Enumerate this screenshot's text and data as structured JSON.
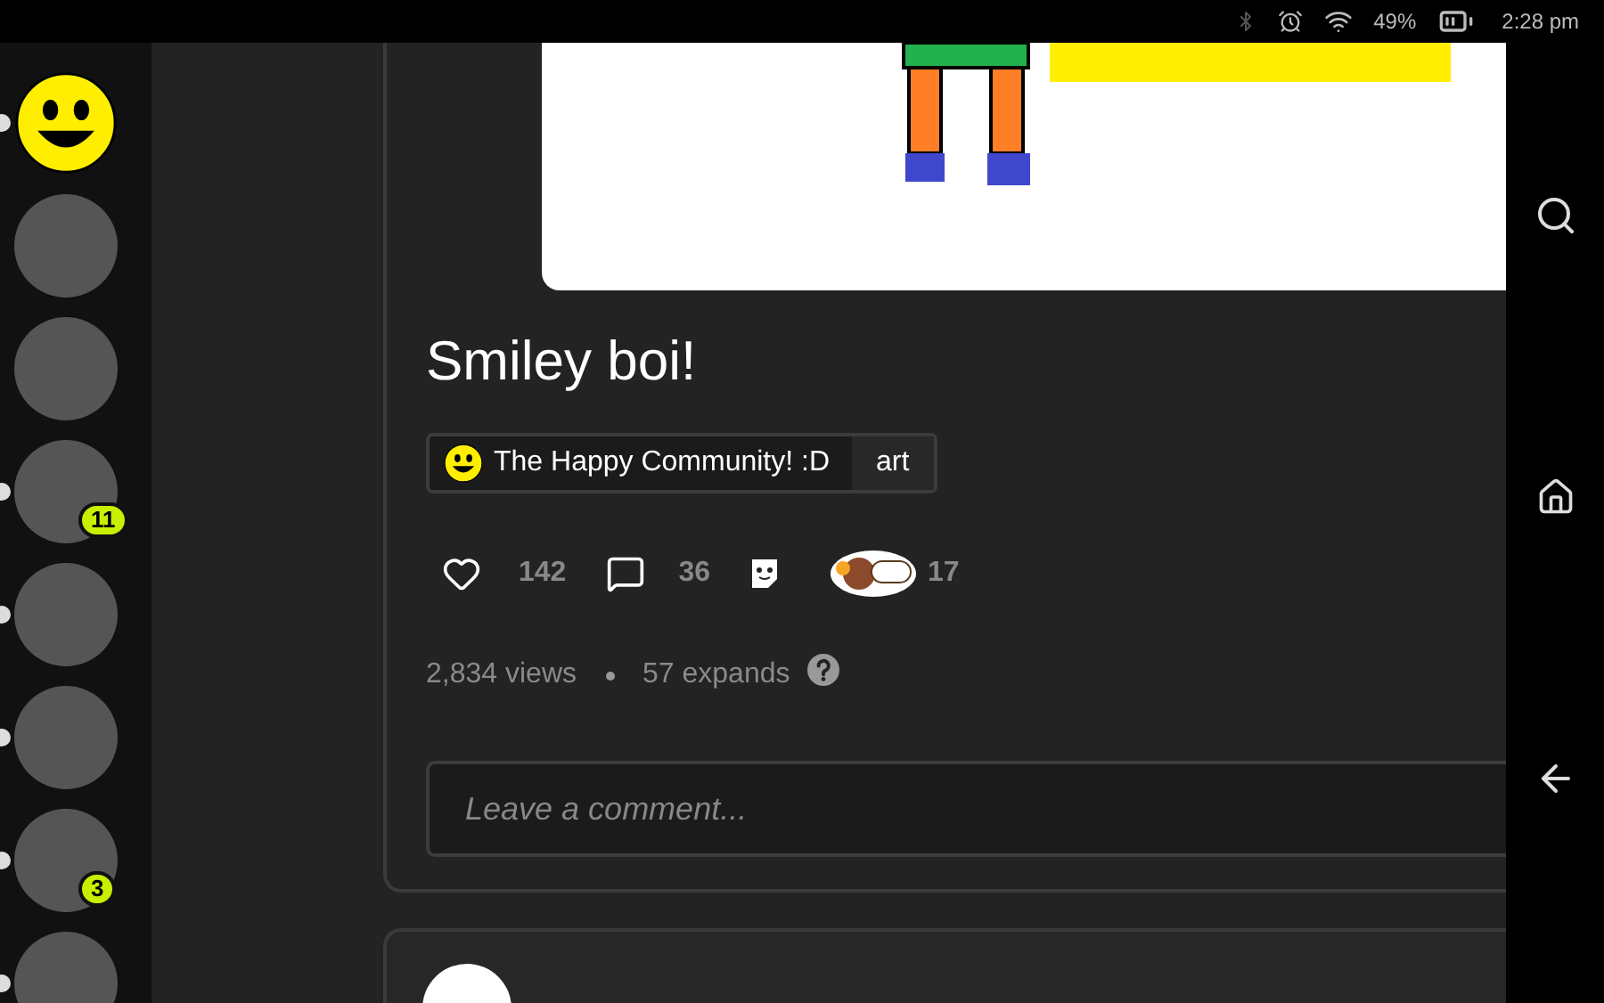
{
  "status_bar": {
    "battery": "49%",
    "time": "2:28 pm"
  },
  "sidebar": {
    "communities": [
      {
        "kind": "smiley",
        "unread": true
      },
      {
        "kind": "image",
        "unread": false
      },
      {
        "kind": "image",
        "unread": false
      },
      {
        "kind": "image",
        "unread": true,
        "badge": "11"
      },
      {
        "kind": "image",
        "unread": true
      },
      {
        "kind": "image",
        "unread": true
      },
      {
        "kind": "image",
        "unread": true,
        "badge": "3"
      },
      {
        "kind": "image",
        "unread": true
      }
    ]
  },
  "post": {
    "title": "Smiley boi!",
    "tag": {
      "community": "The Happy Community! :D",
      "category": "art"
    },
    "actions": {
      "liked": false,
      "likes": "142",
      "comments": "36",
      "props": "17"
    },
    "stats": {
      "views": "2,834 views",
      "expands": "57 expands"
    },
    "comment": {
      "placeholder": "Leave a comment..."
    }
  }
}
